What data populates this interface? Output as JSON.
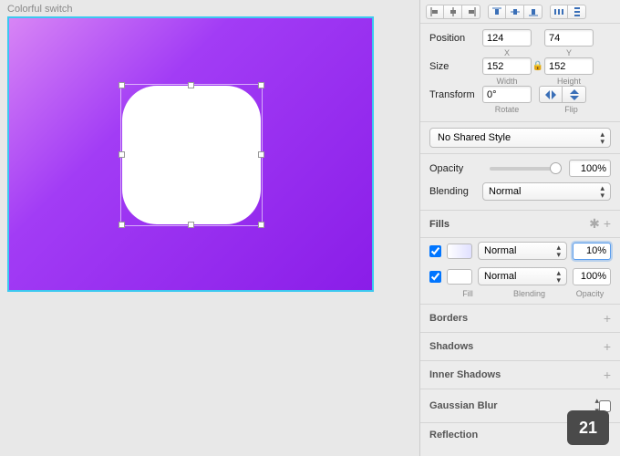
{
  "canvas": {
    "label": "Colorful switch"
  },
  "inspector": {
    "position": {
      "label": "Position",
      "x": "124",
      "y": "74",
      "x_label": "X",
      "y_label": "Y"
    },
    "size": {
      "label": "Size",
      "width": "152",
      "height": "152",
      "w_label": "Width",
      "h_label": "Height"
    },
    "transform": {
      "label": "Transform",
      "rotate": "0°",
      "rotate_label": "Rotate",
      "flip_label": "Flip"
    },
    "shared_style": "No Shared Style",
    "opacity": {
      "label": "Opacity",
      "value": "100%"
    },
    "blending": {
      "label": "Blending",
      "mode": "Normal"
    },
    "fills": {
      "title": "Fills",
      "rows": [
        {
          "checked": true,
          "blend": "Normal",
          "opacity": "10%",
          "selected": true
        },
        {
          "checked": true,
          "blend": "Normal",
          "opacity": "100%",
          "selected": false
        }
      ],
      "sub": {
        "fill": "Fill",
        "blending": "Blending",
        "opacity": "Opacity"
      }
    },
    "borders": "Borders",
    "shadows": "Shadows",
    "inner_shadows": "Inner Shadows",
    "gaussian": "Gaussian Blur",
    "reflection": "Reflection"
  },
  "badge": "21"
}
